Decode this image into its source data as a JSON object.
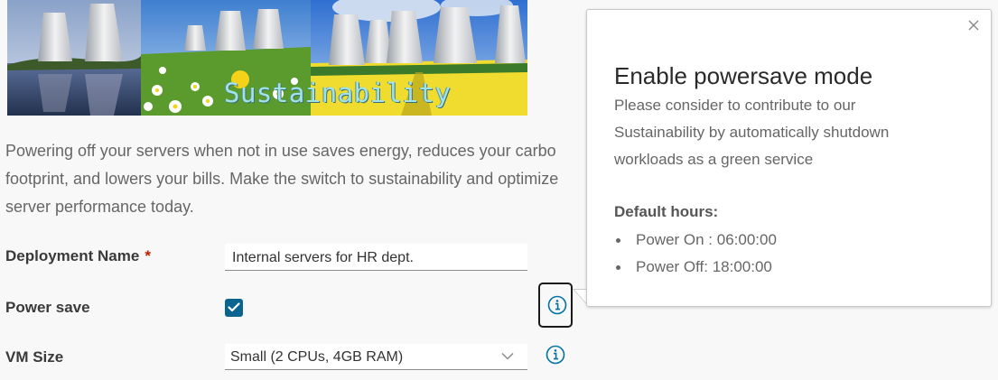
{
  "banner": {
    "caption": "Sustainability"
  },
  "intro": {
    "lines": [
      "Powering off your servers when not in use saves energy, reduces your carbo",
      "footprint, and lowers your bills. Make the switch to sustainability and optimize",
      "server performance today."
    ]
  },
  "form": {
    "deployment_name_label": "Deployment Name",
    "required_marker": "*",
    "deployment_name_value": "Internal servers for HR dept.",
    "power_save_label": "Power save",
    "power_save_checked": true,
    "vm_size_label": "VM Size",
    "vm_size_value": "Small (2 CPUs, 4GB RAM)"
  },
  "popover": {
    "title": "Enable powersave mode",
    "body_lines": [
      "Please consider to contribute to our",
      "Sustainability by automatically shutdown",
      "workloads as a green service"
    ],
    "default_hours_label": "Default hours:",
    "hours": [
      "Power On : 06:00:00",
      "Power Off: 18:00:00"
    ]
  },
  "icons": {
    "info": "info-circle-icon",
    "close": "close-icon",
    "check": "check-icon",
    "chevron": "chevron-down-icon"
  },
  "colors": {
    "accent": "#0b638f",
    "info_icon": "#0072a3",
    "required": "#c21d00"
  }
}
